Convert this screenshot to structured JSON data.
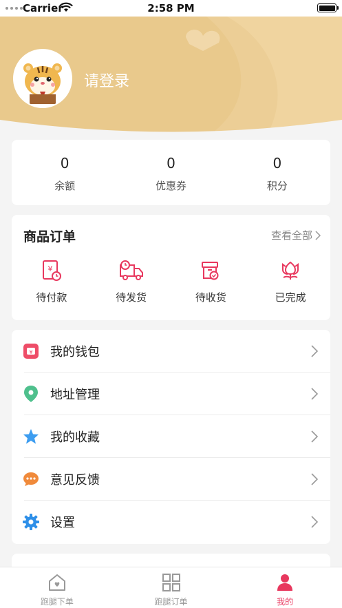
{
  "status_bar": {
    "carrier": "Carrier",
    "time": "2:58 PM"
  },
  "profile": {
    "login_text": "请登录"
  },
  "stats": [
    {
      "value": "0",
      "label": "余额"
    },
    {
      "value": "0",
      "label": "优惠券"
    },
    {
      "value": "0",
      "label": "积分"
    }
  ],
  "orders": {
    "title": "商品订单",
    "view_all": "查看全部",
    "items": [
      {
        "label": "待付款",
        "icon": "pending-payment-icon"
      },
      {
        "label": "待发货",
        "icon": "truck-icon"
      },
      {
        "label": "待收货",
        "icon": "package-check-icon"
      },
      {
        "label": "已完成",
        "icon": "flower-icon"
      }
    ]
  },
  "menu": [
    {
      "label": "我的钱包",
      "icon": "wallet-icon",
      "color": "#ee4d68"
    },
    {
      "label": "地址管理",
      "icon": "location-pin-icon",
      "color": "#4fc08d"
    },
    {
      "label": "我的收藏",
      "icon": "star-icon",
      "color": "#3d9df0"
    },
    {
      "label": "意见反馈",
      "icon": "chat-bubble-icon",
      "color": "#f08a3b"
    },
    {
      "label": "设置",
      "icon": "gear-icon",
      "color": "#2e8fe8"
    }
  ],
  "tabbar": [
    {
      "label": "跑腿下单",
      "icon": "house-icon",
      "active": false
    },
    {
      "label": "跑腿订单",
      "icon": "grid-icon",
      "active": false
    },
    {
      "label": "我的",
      "icon": "user-icon",
      "active": true
    }
  ],
  "colors": {
    "accent": "#e8385e",
    "header_gold": "#e6c383",
    "order_icon": "#e8385e"
  }
}
